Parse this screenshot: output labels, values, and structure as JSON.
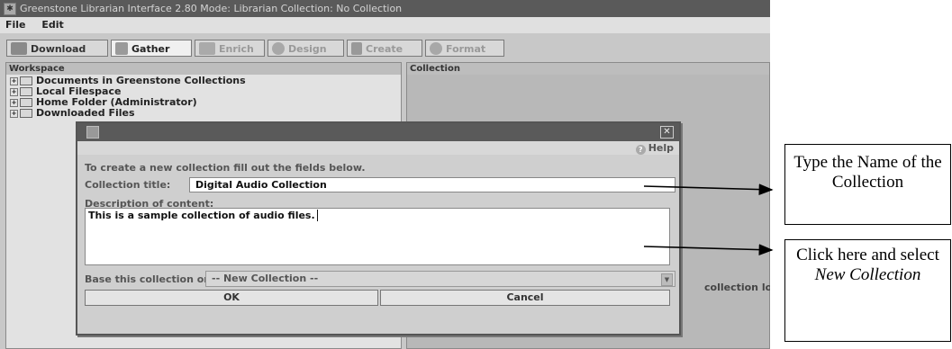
{
  "window": {
    "title": "Greenstone Librarian Interface 2.80  Mode: Librarian  Collection: No Collection"
  },
  "menu": {
    "file": "File",
    "edit": "Edit"
  },
  "tabs": [
    {
      "label": "Download",
      "icon": "download-icon",
      "state": "normal"
    },
    {
      "label": "Gather",
      "icon": "gather-icon",
      "state": "active"
    },
    {
      "label": "Enrich",
      "icon": "enrich-icon",
      "state": "disabled"
    },
    {
      "label": "Design",
      "icon": "design-icon",
      "state": "disabled"
    },
    {
      "label": "Create",
      "icon": "create-icon",
      "state": "disabled"
    },
    {
      "label": "Format",
      "icon": "format-icon",
      "state": "disabled"
    }
  ],
  "workspace": {
    "header": "Workspace",
    "items": [
      "Documents in Greenstone Collections",
      "Local Filespace",
      "Home Folder (Administrator)",
      "Downloaded Files"
    ]
  },
  "collection": {
    "header": "Collection",
    "status_text": "collection loade"
  },
  "dialog": {
    "help": "Help",
    "instruction": "To create a new collection fill out the fields below.",
    "title_label": "Collection title:",
    "title_value": "Digital Audio Collection",
    "desc_label": "Description of content:",
    "desc_value": "This is a sample collection of audio files.",
    "base_label": "Base this collection on:",
    "base_value": "-- New Collection --",
    "ok": "OK",
    "cancel": "Cancel"
  },
  "annotations": {
    "name_callout": "Type the Name of the Collection",
    "select_callout_pre": "Click here and select",
    "select_callout_em": "New Collection"
  },
  "colors": {
    "titlebar": "#5a5a5a",
    "panel": "#c8c8c8",
    "field": "#ffffff"
  }
}
